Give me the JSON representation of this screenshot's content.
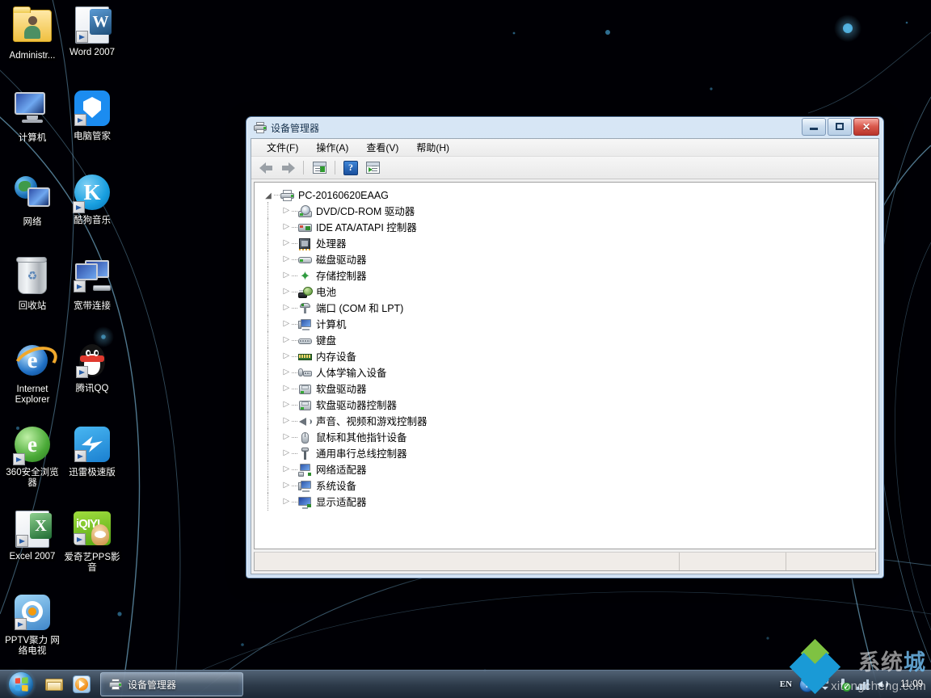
{
  "desktop": {
    "icons": [
      {
        "label": "Administr...",
        "kind": "user-folder",
        "shortcut": false
      },
      {
        "label": "Word 2007",
        "kind": "word",
        "shortcut": true
      },
      {
        "label": "计算机",
        "kind": "computer",
        "shortcut": false
      },
      {
        "label": "电脑管家",
        "kind": "shield",
        "shortcut": true
      },
      {
        "label": "网络",
        "kind": "network",
        "shortcut": false
      },
      {
        "label": "酷狗音乐",
        "kind": "kugou",
        "shortcut": true
      },
      {
        "label": "回收站",
        "kind": "recycle-bin",
        "shortcut": false
      },
      {
        "label": "宽带连接",
        "kind": "broadband",
        "shortcut": true
      },
      {
        "label": "Internet Explorer",
        "kind": "ie",
        "shortcut": false
      },
      {
        "label": "腾讯QQ",
        "kind": "qq",
        "shortcut": true
      },
      {
        "label": "360安全浏览器",
        "kind": "browser360",
        "shortcut": true
      },
      {
        "label": "迅雷极速版",
        "kind": "xunlei",
        "shortcut": true
      },
      {
        "label": "Excel 2007",
        "kind": "excel",
        "shortcut": true
      },
      {
        "label": "爱奇艺PPS影音",
        "kind": "iqiyi",
        "shortcut": true
      },
      {
        "label": "PPTV聚力 网络电视",
        "kind": "pptv",
        "shortcut": true
      }
    ]
  },
  "window": {
    "title": "设备管理器",
    "icon": "printer-icon",
    "buttons": {
      "minimize": "最小化",
      "maximize": "最大化",
      "close": "✕"
    },
    "menu": [
      "文件(F)",
      "操作(A)",
      "查看(V)",
      "帮助(H)"
    ],
    "toolbar": [
      {
        "name": "back-icon",
        "tip": "后退"
      },
      {
        "name": "forward-icon",
        "tip": "前进"
      },
      {
        "name": "properties-icon",
        "tip": "属性"
      },
      {
        "name": "help-icon",
        "tip": "帮助"
      },
      {
        "name": "show-hidden-devices-icon",
        "tip": "扫描检测硬件改动"
      }
    ],
    "statusbar": {
      "pane1": "",
      "pane2": "",
      "pane3": ""
    }
  },
  "tree": {
    "root": {
      "label": "PC-20160620EAAG",
      "icon": "computer-root-icon",
      "expanded": true
    },
    "nodes": [
      {
        "label": "DVD/CD-ROM 驱动器",
        "icon": "dvd-icon"
      },
      {
        "label": "IDE ATA/ATAPI 控制器",
        "icon": "ide-icon"
      },
      {
        "label": "处理器",
        "icon": "cpu-icon"
      },
      {
        "label": "磁盘驱动器",
        "icon": "disk-icon"
      },
      {
        "label": "存储控制器",
        "icon": "storage-icon"
      },
      {
        "label": "电池",
        "icon": "battery-icon"
      },
      {
        "label": "端口 (COM 和 LPT)",
        "icon": "port-icon"
      },
      {
        "label": "计算机",
        "icon": "computer-icon"
      },
      {
        "label": "键盘",
        "icon": "keyboard-icon"
      },
      {
        "label": "内存设备",
        "icon": "memory-icon"
      },
      {
        "label": "人体学输入设备",
        "icon": "hid-icon"
      },
      {
        "label": "软盘驱动器",
        "icon": "floppy-icon"
      },
      {
        "label": "软盘驱动器控制器",
        "icon": "floppy-controller-icon"
      },
      {
        "label": "声音、视频和游戏控制器",
        "icon": "sound-icon"
      },
      {
        "label": "鼠标和其他指针设备",
        "icon": "mouse-icon"
      },
      {
        "label": "通用串行总线控制器",
        "icon": "usb-icon"
      },
      {
        "label": "网络适配器",
        "icon": "network-adapter-icon"
      },
      {
        "label": "系统设备",
        "icon": "system-device-icon"
      },
      {
        "label": "显示适配器",
        "icon": "display-adapter-icon"
      }
    ]
  },
  "taskbar": {
    "start": {
      "name": "start-orb",
      "label": "开始"
    },
    "quicklaunch": [
      {
        "name": "explorer-icon",
        "label": "Windows 资源管理器"
      },
      {
        "name": "media-player-icon",
        "label": "Windows Media Player"
      }
    ],
    "tasks": [
      {
        "label": "设备管理器",
        "icon": "printer-icon",
        "active": true
      }
    ],
    "tray": {
      "language": "EN",
      "help": "?",
      "show_hidden": "显示隐藏的图标",
      "usb": "安全删除硬件",
      "network": "网络",
      "volume": "音量",
      "clock": "11:09"
    }
  },
  "watermark": {
    "cn_left": "系统",
    "cn_right": "城",
    "en": "xitongcheng.com"
  },
  "colors": {
    "accent": "#1a9ad6",
    "close_button": "#d9584c",
    "window_frame": "#d7e6f5",
    "desktop_bg": "#000000",
    "tree_bg": "#ffffff"
  }
}
